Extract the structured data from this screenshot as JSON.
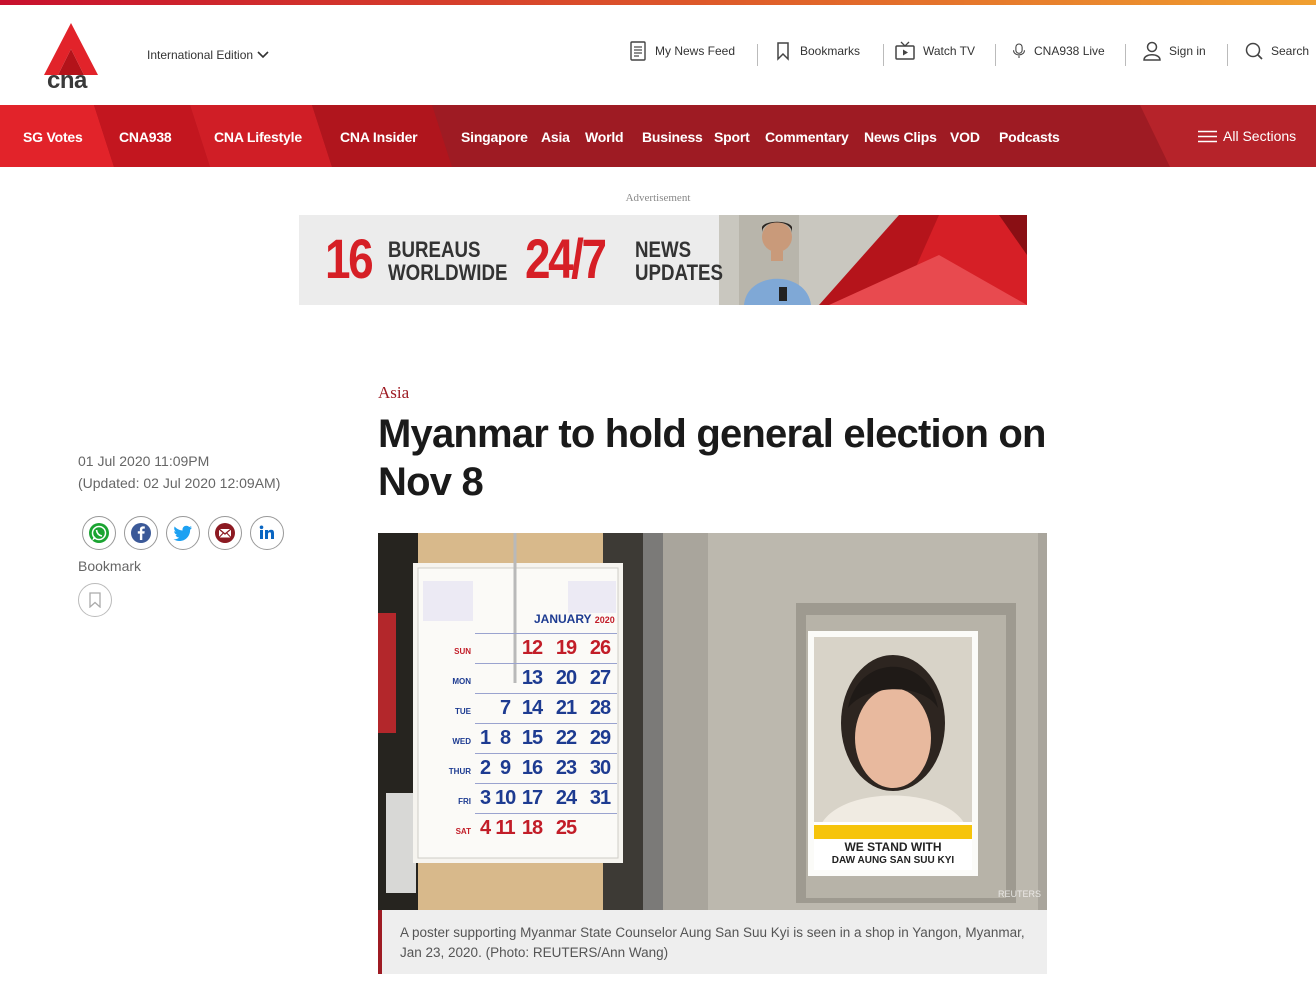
{
  "header": {
    "logo_text": "cna",
    "edition": "International Edition",
    "utilities": [
      {
        "label": "My News Feed",
        "icon": "news-feed-icon"
      },
      {
        "label": "Bookmarks",
        "icon": "bookmark-icon"
      },
      {
        "label": "Watch TV",
        "icon": "tv-icon"
      },
      {
        "label": "CNA938 Live",
        "icon": "microphone-icon"
      },
      {
        "label": "Sign in",
        "icon": "user-icon"
      },
      {
        "label": "Search",
        "icon": "search-icon"
      }
    ]
  },
  "nav": {
    "featured": [
      "SG Votes",
      "CNA938",
      "CNA Lifestyle",
      "CNA Insider"
    ],
    "sections": [
      "Singapore",
      "Asia",
      "World",
      "Business",
      "Sport",
      "Commentary",
      "News Clips",
      "VOD",
      "Podcasts"
    ],
    "all_sections": "All Sections"
  },
  "ad": {
    "label": "Advertisement",
    "num1": "16",
    "text1_line1": "BUREAUS",
    "text1_line2": "WORLDWIDE",
    "num2": "24/7",
    "text2_line1": "NEWS",
    "text2_line2": "UPDATES"
  },
  "article": {
    "section": "Asia",
    "title": "Myanmar to hold general election on Nov 8",
    "published": "01 Jul 2020 11:09PM",
    "updated": "(Updated: 02 Jul 2020 12:09AM)",
    "share_icons": [
      "whatsapp-icon",
      "facebook-icon",
      "twitter-icon",
      "email-icon",
      "linkedin-icon"
    ],
    "bookmark_label": "Bookmark",
    "caption": "A poster supporting Myanmar State Counselor Aung San Suu Kyi is seen in a shop in Yangon, Myanmar, Jan 23, 2020. (Photo: REUTERS/Ann Wang)"
  },
  "photo": {
    "calendar_month": "JANUARY",
    "calendar_year": "2020",
    "calendar_days": [
      "SUN",
      "MON",
      "TUE",
      "WED",
      "THUR",
      "FRI",
      "SAT"
    ],
    "calendar_rows": [
      [
        "",
        "",
        "12",
        "19",
        "26"
      ],
      [
        "",
        "",
        "13",
        "20",
        "27"
      ],
      [
        "",
        "7",
        "14",
        "21",
        "28"
      ],
      [
        "1",
        "8",
        "15",
        "22",
        "29"
      ],
      [
        "2",
        "9",
        "16",
        "23",
        "30"
      ],
      [
        "3",
        "10",
        "17",
        "24",
        "31"
      ],
      [
        "4",
        "11",
        "18",
        "25",
        ""
      ]
    ],
    "poster_line1": "WE STAND WITH",
    "poster_line2": "DAW AUNG SAN SUU KYI",
    "watermark": "REUTERS"
  },
  "colors": {
    "brand_red": "#9e1b23",
    "accent_red": "#d61f26"
  }
}
